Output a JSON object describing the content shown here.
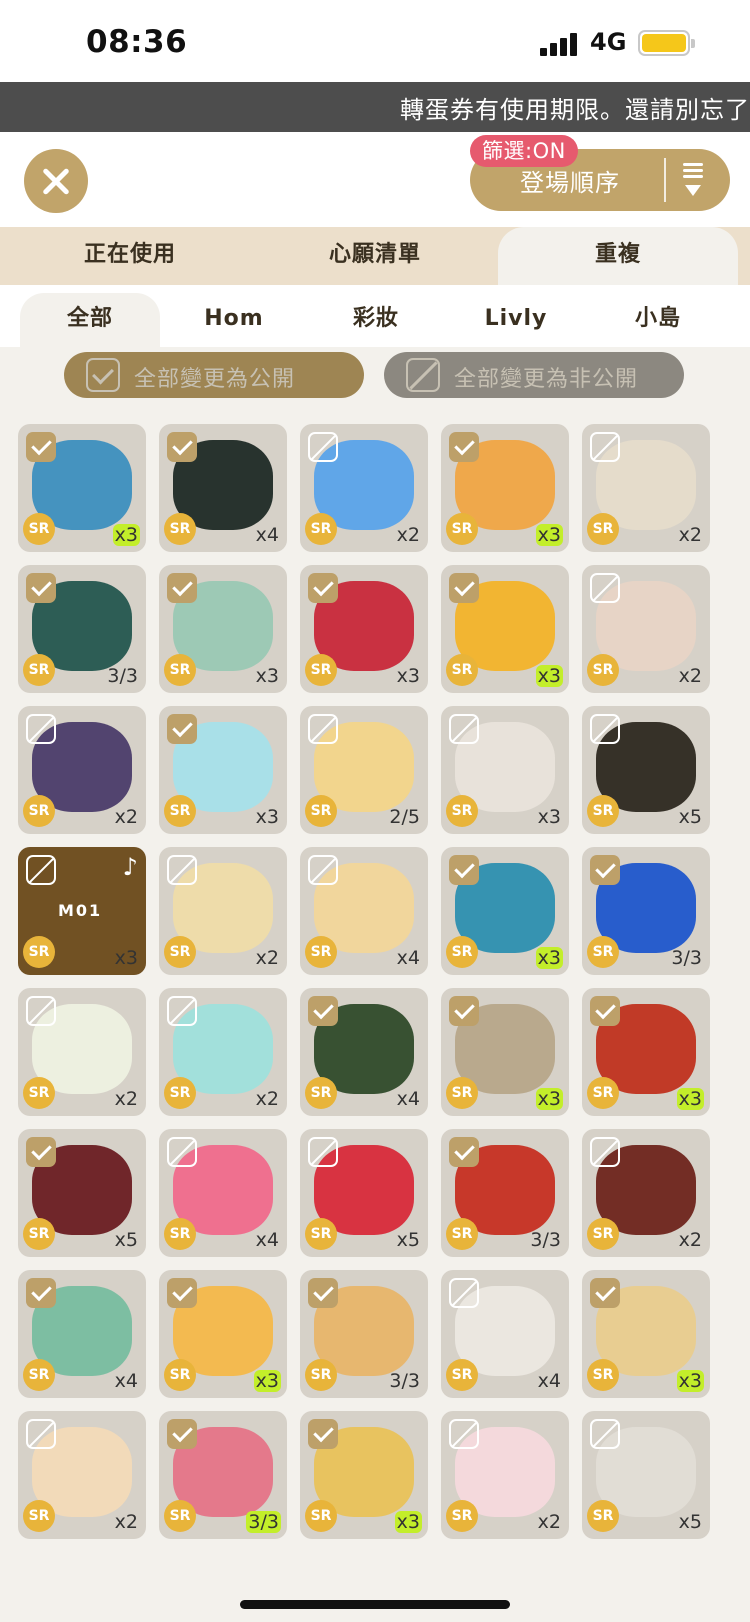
{
  "status_bar": {
    "time": "08:36",
    "network": "4G"
  },
  "marquee": {
    "text": "轉蛋券有使用期限。還請別忘了使"
  },
  "header": {
    "sort_label": "登場順序",
    "filter_badge": "篩選:ON"
  },
  "top_tabs": [
    "正在使用",
    "心願清單",
    "重複"
  ],
  "sub_tabs": [
    "全部",
    "Hom",
    "彩妝",
    "Livly",
    "小島"
  ],
  "bulk_actions": {
    "public_label": "全部變更為公開",
    "private_label": "全部變更為非公開"
  },
  "icons": [
    "close-icon",
    "sort-icon",
    "checkbox-icon",
    "music-note-icon"
  ],
  "colors": {
    "gold": "#c1a46a",
    "filter_badge": "#e65a6e",
    "rarity_badge": "#e8b43a",
    "highlight_qty": "#c3ee2a"
  },
  "items": [
    {
      "checked": true,
      "rarity": "SR",
      "qty": "x3",
      "highlight": true,
      "art": "#3d8fbf"
    },
    {
      "checked": true,
      "rarity": "SR",
      "qty": "x4",
      "highlight": false,
      "art": "#1f2a26"
    },
    {
      "checked": false,
      "rarity": "SR",
      "qty": "x2",
      "highlight": false,
      "art": "#5aa3ea"
    },
    {
      "checked": true,
      "rarity": "SR",
      "qty": "x3",
      "highlight": true,
      "art": "#f0a545"
    },
    {
      "checked": false,
      "rarity": "SR",
      "qty": "x2",
      "highlight": false,
      "art": "#e6dccb"
    },
    {
      "checked": true,
      "rarity": "SR",
      "qty": "3/3",
      "highlight": false,
      "art": "#24564f"
    },
    {
      "checked": true,
      "rarity": "SR",
      "qty": "x3",
      "highlight": false,
      "art": "#9ac8b4"
    },
    {
      "checked": true,
      "rarity": "SR",
      "qty": "x3",
      "highlight": false,
      "art": "#c8283a"
    },
    {
      "checked": true,
      "rarity": "SR",
      "qty": "x3",
      "highlight": true,
      "art": "#f3b32a"
    },
    {
      "checked": false,
      "rarity": "SR",
      "qty": "x2",
      "highlight": false,
      "art": "#e8d4c6"
    },
    {
      "checked": false,
      "rarity": "SR",
      "qty": "x2",
      "highlight": false,
      "art": "#4b3c6a"
    },
    {
      "checked": true,
      "rarity": "SR",
      "qty": "x3",
      "highlight": false,
      "art": "#a7e0ea"
    },
    {
      "checked": false,
      "rarity": "SR",
      "qty": "2/5",
      "highlight": false,
      "art": "#f3d58a"
    },
    {
      "checked": false,
      "rarity": "SR",
      "qty": "x3",
      "highlight": false,
      "art": "#e9e3db"
    },
    {
      "checked": false,
      "rarity": "SR",
      "qty": "x5",
      "highlight": false,
      "art": "#2d2820"
    },
    {
      "checked": false,
      "rarity": "SR",
      "qty": "x3",
      "highlight": false,
      "art": "#6b4a1a",
      "banner": "M01",
      "music": true
    },
    {
      "checked": false,
      "rarity": "SR",
      "qty": "x2",
      "highlight": false,
      "art": "#efdca9"
    },
    {
      "checked": false,
      "rarity": "SR",
      "qty": "x4",
      "highlight": false,
      "art": "#f2d69a"
    },
    {
      "checked": true,
      "rarity": "SR",
      "qty": "x3",
      "highlight": true,
      "art": "#2d8fb0"
    },
    {
      "checked": true,
      "rarity": "SR",
      "qty": "3/3",
      "highlight": false,
      "art": "#1f56cc"
    },
    {
      "checked": false,
      "rarity": "SR",
      "qty": "x2",
      "highlight": false,
      "art": "#eef1e2"
    },
    {
      "checked": false,
      "rarity": "SR",
      "qty": "x2",
      "highlight": false,
      "art": "#9fe0dc"
    },
    {
      "checked": true,
      "rarity": "SR",
      "qty": "x4",
      "highlight": false,
      "art": "#2f4a2a"
    },
    {
      "checked": true,
      "rarity": "SR",
      "qty": "x3",
      "highlight": true,
      "art": "#b7a68a"
    },
    {
      "checked": true,
      "rarity": "SR",
      "qty": "x3",
      "highlight": true,
      "art": "#c0321f"
    },
    {
      "checked": true,
      "rarity": "SR",
      "qty": "x5",
      "highlight": false,
      "art": "#6a1c22"
    },
    {
      "checked": false,
      "rarity": "SR",
      "qty": "x4",
      "highlight": false,
      "art": "#f06a8c"
    },
    {
      "checked": false,
      "rarity": "SR",
      "qty": "x5",
      "highlight": false,
      "art": "#d82a3a"
    },
    {
      "checked": true,
      "rarity": "SR",
      "qty": "3/3",
      "highlight": false,
      "art": "#c62f22"
    },
    {
      "checked": false,
      "rarity": "SR",
      "qty": "x2",
      "highlight": false,
      "art": "#6e241c"
    },
    {
      "checked": true,
      "rarity": "SR",
      "qty": "x4",
      "highlight": false,
      "art": "#78bda0"
    },
    {
      "checked": true,
      "rarity": "SR",
      "qty": "x3",
      "highlight": true,
      "art": "#f4b84a"
    },
    {
      "checked": true,
      "rarity": "SR",
      "qty": "3/3",
      "highlight": false,
      "art": "#e8b56a"
    },
    {
      "checked": false,
      "rarity": "SR",
      "qty": "x4",
      "highlight": false,
      "art": "#ece8e1"
    },
    {
      "checked": true,
      "rarity": "SR",
      "qty": "x3",
      "highlight": true,
      "art": "#e9cc8e"
    },
    {
      "checked": false,
      "rarity": "SR",
      "qty": "x2",
      "highlight": false,
      "art": "#f3dab8"
    },
    {
      "checked": true,
      "rarity": "SR",
      "qty": "3/3",
      "highlight": true,
      "art": "#e57488"
    },
    {
      "checked": true,
      "rarity": "SR",
      "qty": "x3",
      "highlight": true,
      "art": "#e9c25a"
    },
    {
      "checked": false,
      "rarity": "SR",
      "qty": "x2",
      "highlight": false,
      "art": "#f5d9dd"
    },
    {
      "checked": false,
      "rarity": "SR",
      "qty": "x5",
      "highlight": false,
      "art": "#e2ddd6"
    }
  ]
}
